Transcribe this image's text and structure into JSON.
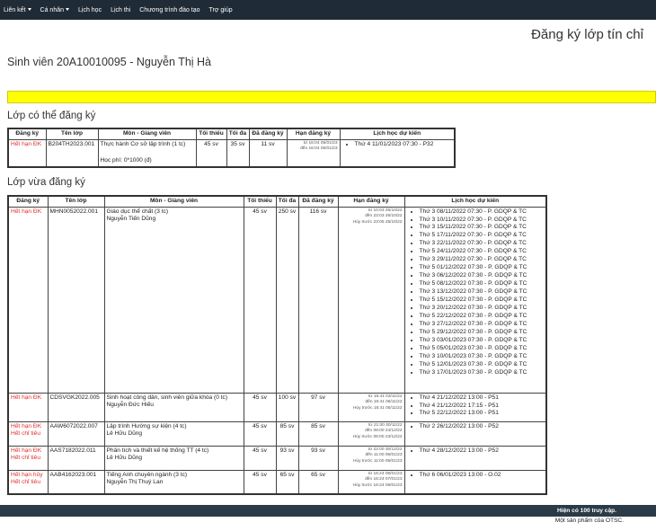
{
  "nav": {
    "items": [
      {
        "label": "Liên kết",
        "dropdown": true
      },
      {
        "label": "Cá nhân",
        "dropdown": true
      },
      {
        "label": "Lịch học",
        "dropdown": false
      },
      {
        "label": "Lịch thi",
        "dropdown": false
      },
      {
        "label": "Chương trình đào tạo",
        "dropdown": false
      },
      {
        "label": "Trợ giúp",
        "dropdown": false
      }
    ]
  },
  "page": {
    "heading": "Đăng ký lớp tín chỉ",
    "student": "Sinh viên 20A10010095 - Nguyễn Thị Hà",
    "notice_color": "#ffff00"
  },
  "available": {
    "title": "Lớp có thể đăng ký",
    "headers": [
      "Đăng ký",
      "Tên lớp",
      "Môn - Giảng viên",
      "Tối thiểu",
      "Tối đa",
      "Đã đăng ký",
      "Hạn đăng ký",
      "Lịch học dự kiến"
    ],
    "rows": [
      {
        "status": [
          "Hết hạn ĐK"
        ],
        "class_code": "B204TH2023.001",
        "course": "Thực hành Cơ sở lập trình (1 tc)",
        "lecturer": "",
        "fee": "Học phí: 0*1000 (đ)",
        "min": "45 sv",
        "max": "35 sv",
        "registered": "11 sv",
        "deadline": [
          "từ 16:04 05/01/23",
          "đến 16:04 05/01/23"
        ],
        "schedule": [
          "Thứ 4 11/01/2023 07:30 - P32"
        ]
      }
    ]
  },
  "registered": {
    "title": "Lớp vừa đăng ký",
    "headers": [
      "Đăng ký",
      "Tên lớp",
      "Môn - Giảng viên",
      "Tối thiểu",
      "Tối đa",
      "Đã đăng ký",
      "Hạn đăng ký",
      "Lịch học dự kiến"
    ],
    "rows": [
      {
        "status": [
          "Hết hạn ĐK"
        ],
        "class_code": "MHN0052022.001",
        "course": "Giáo dục thể chất (3 tc)",
        "lecturer": "Nguyễn Tiến Dũng",
        "min": "45 sv",
        "max": "250 sv",
        "registered": "116 sv",
        "deadline": [
          "từ 10:03 25/10/22",
          "đến 23:03 26/10/22",
          "Hủy trước 23:05 25/10/22"
        ],
        "schedule": [
          "Thứ 3 08/11/2022 07:30 - P. GDQP & TC",
          "Thứ 3 10/11/2022 07:30 - P. GDQP & TC",
          "Thứ 3 15/11/2022 07:30 - P. GDQP & TC",
          "Thứ 5 17/11/2022 07:30 - P. GDQP & TC",
          "Thứ 3 22/11/2022 07:30 - P. GDQP & TC",
          "Thứ 5 24/11/2022 07:30 - P. GDQP & TC",
          "Thứ 3 29/11/2022 07:30 - P. GDQP & TC",
          "Thứ 5 01/12/2022 07:30 - P. GDQP & TC",
          "Thứ 3 06/12/2022 07:30 - P. GDQP & TC",
          "Thứ 5 08/12/2022 07:30 - P. GDQP & TC",
          "Thứ 3 13/12/2022 07:30 - P. GDQP & TC",
          "Thứ 5 15/12/2022 07:30 - P. GDQP & TC",
          "Thứ 3 20/12/2022 07:30 - P. GDQP & TC",
          "Thứ 5 22/12/2022 07:30 - P. GDQP & TC",
          "Thứ 3 27/12/2022 07:30 - P. GDQP & TC",
          "Thứ 5 29/12/2022 07:30 - P. GDQP & TC",
          "Thứ 3 03/01/2023 07:30 - P. GDQP & TC",
          "Thứ 5 05/01/2023 07:30 - P. GDQP & TC",
          "Thứ 3 10/01/2023 07:30 - P. GDQP & TC",
          "Thứ 5 12/01/2023 07:30 - P. GDQP & TC",
          "Thứ 3 17/01/2023 07:30 - P. GDQP & TC"
        ]
      },
      {
        "status": [
          "Hết hạn ĐK"
        ],
        "class_code": "CDSVGK2022.005",
        "course": "Sinh hoạt công dân, sinh viên giữa khóa (0 tc)",
        "lecturer": "Nguyễn Đức Hiếu",
        "min": "45 sv",
        "max": "100 sv",
        "registered": "97 sv",
        "deadline": [
          "từ 16:41 03/11/22",
          "đến 16:41 06/11/22",
          "Hủy trước 16:41 05/11/22"
        ],
        "schedule": [
          "Thứ 4 21/12/2022 13:00 - P51",
          "Thứ 4 21/12/2022 17:15 - P51",
          "Thứ 5 22/12/2022 13:00 - P51"
        ]
      },
      {
        "status": [
          "Hết hạn ĐK",
          "Hết chỉ tiêu"
        ],
        "class_code": "AAW6072022.007",
        "course": "Lập trình Hướng sự kiện (4 tc)",
        "lecturer": "Lê Hữu Dũng",
        "min": "45 sv",
        "max": "85 sv",
        "registered": "85 sv",
        "deadline": [
          "từ 21:00 30/11/22",
          "đến 08:00 24/12/22",
          "Hủy trước 08:00 23/12/22"
        ],
        "schedule": [
          "Thứ 2 26/12/2022 13:00 - P52"
        ]
      },
      {
        "status": [
          "Hết hạn ĐK",
          "Hết chỉ tiêu"
        ],
        "class_code": "AAS7182022.011",
        "course": "Phân tích và thiết kế hệ thống TT (4 tc)",
        "lecturer": "Lê Hữu Dũng",
        "min": "45 sv",
        "max": "93 sv",
        "registered": "93 sv",
        "deadline": [
          "từ 22:00 30/12/22",
          "đến 11:00 06/01/23",
          "Hủy trước 11:00 05/01/23"
        ],
        "schedule": [
          "Thứ 4 28/12/2022 13:00 - P52"
        ]
      },
      {
        "status": [
          "Hết hạn hủy",
          "Hết chỉ tiêu"
        ],
        "class_code": "AAB4162023.001",
        "course": "Tiếng Anh chuyên ngành (3 tc)",
        "lecturer": "Nguyễn Thị Thuý Lan",
        "min": "45 sv",
        "max": "65 sv",
        "registered": "65 sv",
        "deadline": [
          "từ 16:24 05/01/23",
          "đến 16:24 07/01/23",
          "Hủy trước 16:24 06/01/23"
        ],
        "schedule": [
          "Thứ 6 06/01/2023 13:00 - O.02"
        ]
      }
    ]
  },
  "footer": {
    "visitors": "Hiện có 100 truy cập.",
    "credit": "Một sản phẩm của OTSC."
  }
}
